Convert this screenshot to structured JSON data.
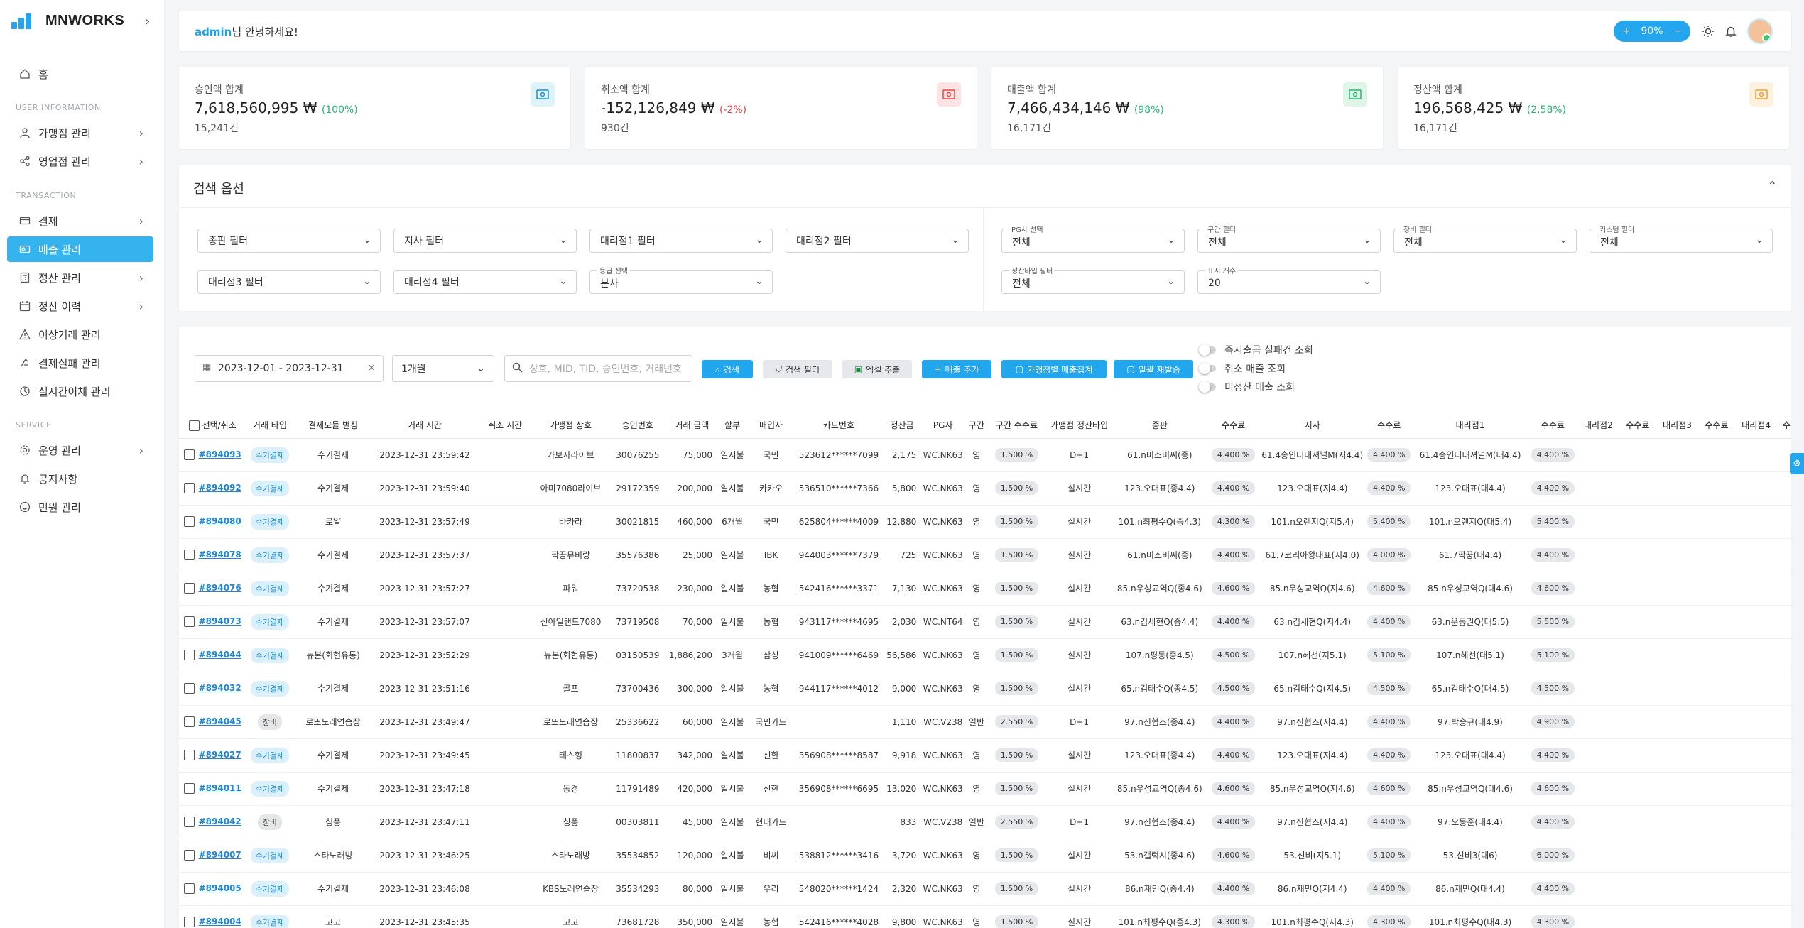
{
  "brand": {
    "name": "MNWORKS",
    "colors": {
      "accent": "#35b3ee",
      "positive": "#2bb673",
      "negative": "#e84545"
    }
  },
  "sidebar": {
    "home": "홈",
    "sections": {
      "user": "USER INFORMATION",
      "transaction": "TRANSACTION",
      "service": "SERVICE"
    },
    "items": [
      {
        "label": "가맹점 관리",
        "icon": "user-icon"
      },
      {
        "label": "영업점 관리",
        "icon": "share-icon"
      },
      {
        "label": "결제",
        "icon": "card-icon"
      },
      {
        "label": "매출 관리",
        "icon": "sales-icon",
        "active": true
      },
      {
        "label": "정산 관리",
        "icon": "calculator-icon"
      },
      {
        "label": "정산 이력",
        "icon": "calendar-icon"
      },
      {
        "label": "이상거래 관리",
        "icon": "warning-icon"
      },
      {
        "label": "결제실패 관리",
        "icon": "fail-icon"
      },
      {
        "label": "실시간이체 관리",
        "icon": "history-icon"
      },
      {
        "label": "운영 관리",
        "icon": "gear-icon"
      },
      {
        "label": "공지사항",
        "icon": "bell-icon"
      },
      {
        "label": "민원 관리",
        "icon": "smile-icon"
      }
    ]
  },
  "header": {
    "user": "admin",
    "greeting": "님 안녕하세요!",
    "zoom": "90%"
  },
  "cards": [
    {
      "label": "승인액 합계",
      "amount": "7,618,560,995 ₩",
      "pct": "(100%)",
      "tone": "pos",
      "count": "15,241건",
      "icon": "money-icon",
      "icon_bg": "#dff3fb",
      "icon_color": "#1c91d6"
    },
    {
      "label": "취소액 합계",
      "amount": "-152,126,849 ₩",
      "pct": "(-2%)",
      "tone": "neg",
      "count": "930건",
      "icon": "money-icon",
      "icon_bg": "#fde3e3",
      "icon_color": "#e84545"
    },
    {
      "label": "매출액 합계",
      "amount": "7,466,434,146 ₩",
      "pct": "(98%)",
      "tone": "pos",
      "count": "16,171건",
      "icon": "money-icon",
      "icon_bg": "#def6e7",
      "icon_color": "#2bb673"
    },
    {
      "label": "정산액 합계",
      "amount": "196,568,425 ₩",
      "pct": "(2.58%)",
      "tone": "pos",
      "count": "16,171건",
      "icon": "money-icon",
      "icon_bg": "#fdf0dc",
      "icon_color": "#f0a030"
    }
  ],
  "search_options": {
    "title": "검색 옵션",
    "filters_left": [
      {
        "label": "",
        "value": "종판 필터"
      },
      {
        "label": "",
        "value": "지사 필터"
      },
      {
        "label": "",
        "value": "대리점1 필터"
      },
      {
        "label": "",
        "value": "대리점2 필터"
      },
      {
        "label": "",
        "value": "대리점3 필터"
      },
      {
        "label": "",
        "value": "대리점4 필터"
      },
      {
        "label": "등급 선택",
        "value": "본사"
      }
    ],
    "filters_right": [
      {
        "label": "PG사 선택",
        "value": "전체"
      },
      {
        "label": "구간 필터",
        "value": "전체"
      },
      {
        "label": "장비 필터",
        "value": "전체"
      },
      {
        "label": "커스텀 필터",
        "value": "전체"
      },
      {
        "label": "정산타입 필터",
        "value": "전체"
      },
      {
        "label": "표시 개수",
        "value": "20"
      }
    ]
  },
  "toolbar": {
    "date_range": "2023-12-01  -  2023-12-31",
    "period": "1개월",
    "search_placeholder": "상호, MID, TID, 승인번호, 거래번호",
    "buttons": [
      "검색",
      "검색 필터",
      "엑셀 추출",
      "매출 추가",
      "가맹점별 매출집계",
      "일괄 재발송"
    ],
    "toggles": [
      "즉시출금 실패건 조회",
      "취소 매출 조회",
      "미정산 매출 조회"
    ]
  },
  "table": {
    "columns": [
      "선택/취소",
      "거래 타입",
      "결제모듈 별칭",
      "거래 시간",
      "취소 시간",
      "가맹점 상호",
      "승인번호",
      "거래 금액",
      "할부",
      "매입사",
      "카드번호",
      "정산금",
      "PG사",
      "구간",
      "구간 수수료",
      "가맹점 정산타입",
      "종판",
      "수수료",
      "지사",
      "수수료",
      "대리점1",
      "수수료",
      "대리점2",
      "수수료",
      "대리점3",
      "수수료",
      "대리점4",
      "수수"
    ],
    "rows": [
      [
        "#894093",
        "수기결제",
        "수기결제",
        "2023-12-31 23:59:42",
        "",
        "가보자라이브",
        "30076255",
        "75,000",
        "일시불",
        "국민",
        "523612******7099",
        "2,175",
        "WC.NK63",
        "영",
        "1.500 %",
        "D+1",
        "61.n미소비씨(종)",
        "4.400 %",
        "61.4송인터내셔널M(지4.4)",
        "4.400 %",
        "61.4송인터내셔널M(대4.4)",
        "4.400 %"
      ],
      [
        "#894092",
        "수기결제",
        "수기결제",
        "2023-12-31 23:59:40",
        "",
        "아미7080라이브",
        "29172359",
        "200,000",
        "일시불",
        "카카오",
        "536510******7366",
        "5,800",
        "WC.NK63",
        "영",
        "1.500 %",
        "실시간",
        "123.오대표(종4.4)",
        "4.400 %",
        "123.오대표(지4.4)",
        "4.400 %",
        "123.오대표(대4.4)",
        "4.400 %"
      ],
      [
        "#894080",
        "수기결제",
        "로얄",
        "2023-12-31 23:57:49",
        "",
        "바카라",
        "30021815",
        "460,000",
        "6개월",
        "국민",
        "625804******4009",
        "12,880",
        "WC.NK63",
        "영",
        "1.500 %",
        "실시간",
        "101.n최평수Q(종4.3)",
        "4.300 %",
        "101.n오렌지Q(지5.4)",
        "5.400 %",
        "101.n오렌지Q(대5.4)",
        "5.400 %"
      ],
      [
        "#894078",
        "수기결제",
        "수기결제",
        "2023-12-31 23:57:37",
        "",
        "짝꿍뮤비랑",
        "35576386",
        "25,000",
        "일시불",
        "IBK",
        "944003******7379",
        "725",
        "WC.NK63",
        "영",
        "1.500 %",
        "실시간",
        "61.n미소비씨(종)",
        "4.400 %",
        "61.7코리아왕대표(지4.0)",
        "4.000 %",
        "61.7짝꿍(대4.4)",
        "4.400 %"
      ],
      [
        "#894076",
        "수기결제",
        "수기결제",
        "2023-12-31 23:57:27",
        "",
        "파워",
        "73720538",
        "230,000",
        "일시불",
        "농협",
        "542416******3371",
        "7,130",
        "WC.NK63",
        "영",
        "1.500 %",
        "실시간",
        "85.n우성교역Q(종4.6)",
        "4.600 %",
        "85.n우성교역Q(지4.6)",
        "4.600 %",
        "85.n우성교역Q(대4.6)",
        "4.600 %"
      ],
      [
        "#894073",
        "수기결제",
        "수기결제",
        "2023-12-31 23:57:07",
        "",
        "신아일랜드7080",
        "73719508",
        "70,000",
        "일시불",
        "농협",
        "943117******4695",
        "2,030",
        "WC.NT64",
        "영",
        "1.500 %",
        "실시간",
        "63.n김세현Q(종4.4)",
        "4.400 %",
        "63.n김세현Q(지4.4)",
        "4.400 %",
        "63.n운동권Q(대5.5)",
        "5.500 %"
      ],
      [
        "#894044",
        "수기결제",
        "뉴본(회현유통)",
        "2023-12-31 23:52:29",
        "",
        "뉴본(회현유통)",
        "03150539",
        "1,886,200",
        "3개월",
        "삼성",
        "941009******6469",
        "56,586",
        "WC.NK63",
        "영",
        "1.500 %",
        "실시간",
        "107.n평동(종4.5)",
        "4.500 %",
        "107.n헤선(지5.1)",
        "5.100 %",
        "107.n헤선(대5.1)",
        "5.100 %"
      ],
      [
        "#894032",
        "수기결제",
        "수기결제",
        "2023-12-31 23:51:16",
        "",
        "골프",
        "73700436",
        "300,000",
        "일시불",
        "농협",
        "944117******4012",
        "9,000",
        "WC.NK63",
        "영",
        "1.500 %",
        "실시간",
        "65.n김태수Q(종4.5)",
        "4.500 %",
        "65.n김태수Q(지4.5)",
        "4.500 %",
        "65.n김태수Q(대4.5)",
        "4.500 %"
      ],
      [
        "#894045",
        "장비",
        "로또노래연습장",
        "2023-12-31 23:49:47",
        "",
        "로또노래연습장",
        "25336622",
        "60,000",
        "일시불",
        "국민카드",
        "",
        "1,110",
        "WC.V238",
        "일반",
        "2.550 %",
        "D+1",
        "97.n진협즈(종4.4)",
        "4.400 %",
        "97.n진협즈(지4.4)",
        "4.400 %",
        "97.박승규(대4.9)",
        "4.900 %"
      ],
      [
        "#894027",
        "수기결제",
        "수기결제",
        "2023-12-31 23:49:45",
        "",
        "테스형",
        "11800837",
        "342,000",
        "일시불",
        "신한",
        "356908******8587",
        "9,918",
        "WC.NK63",
        "영",
        "1.500 %",
        "실시간",
        "123.오대표(종4.4)",
        "4.400 %",
        "123.오대표(지4.4)",
        "4.400 %",
        "123.오대표(대4.4)",
        "4.400 %"
      ],
      [
        "#894011",
        "수기결제",
        "수기결제",
        "2023-12-31 23:47:18",
        "",
        "동경",
        "11791489",
        "420,000",
        "일시불",
        "신한",
        "356908******6695",
        "13,020",
        "WC.NK63",
        "영",
        "1.500 %",
        "실시간",
        "85.n우성교역Q(종4.6)",
        "4.600 %",
        "85.n우성교역Q(지4.6)",
        "4.600 %",
        "85.n우성교역Q(대4.6)",
        "4.600 %"
      ],
      [
        "#894042",
        "장비",
        "칭퐁",
        "2023-12-31 23:47:11",
        "",
        "칭퐁",
        "00303811",
        "45,000",
        "일시불",
        "현대카드",
        "",
        "833",
        "WC.V238",
        "일반",
        "2.550 %",
        "D+1",
        "97.n진협즈(종4.4)",
        "4.400 %",
        "97.n진협즈(지4.4)",
        "4.400 %",
        "97.오동준(대4.4)",
        "4.400 %"
      ],
      [
        "#894007",
        "수기결제",
        "스타노래방",
        "2023-12-31 23:46:25",
        "",
        "스타노래방",
        "35534852",
        "120,000",
        "일시불",
        "비씨",
        "538812******3416",
        "3,720",
        "WC.NK63",
        "영",
        "1.500 %",
        "실시간",
        "53.n갤럭시(종4.6)",
        "4.600 %",
        "53.신비(지5.1)",
        "5.100 %",
        "53.신비3(대6)",
        "6.000 %"
      ],
      [
        "#894005",
        "수기결제",
        "수기결제",
        "2023-12-31 23:46:08",
        "",
        "KBS노래연습장",
        "35534293",
        "80,000",
        "일시불",
        "우리",
        "548020******1424",
        "2,320",
        "WC.NK63",
        "영",
        "1.500 %",
        "실시간",
        "86.n재민Q(종4.4)",
        "4.400 %",
        "86.n재민Q(지4.4)",
        "4.400 %",
        "86.n재민Q(대4.4)",
        "4.400 %"
      ],
      [
        "#894004",
        "수기결제",
        "고고",
        "2023-12-31 23:45:35",
        "",
        "고고",
        "73681728",
        "350,000",
        "일시불",
        "농협",
        "542416******4028",
        "9,800",
        "WC.NK63",
        "영",
        "1.500 %",
        "실시간",
        "101.n최평수Q(종4.3)",
        "4.300 %",
        "101.n최평수Q(지4.3)",
        "4.300 %",
        "101.n최평수Q(대4.3)",
        "4.300 %"
      ]
    ]
  }
}
